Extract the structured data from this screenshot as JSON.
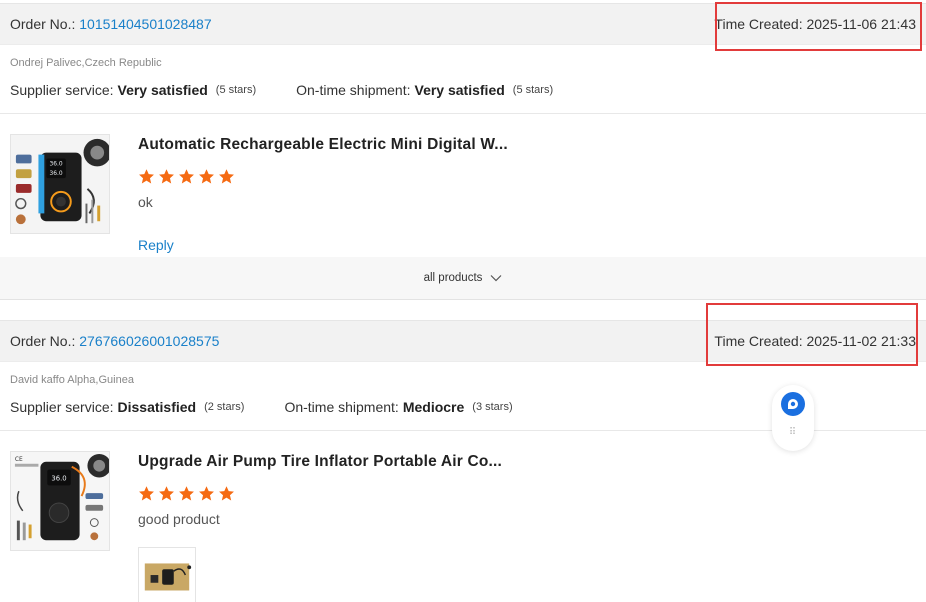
{
  "orders": [
    {
      "order_no_label": "Order No.:",
      "order_no": "10151404501028487",
      "time_created": "Time Created: 2025-11-06 21:43",
      "buyer": "Ondrej Palivec,Czech Republic",
      "supplier_label": "Supplier service:",
      "supplier_value": "Very satisfied",
      "supplier_stars": "(5 stars)",
      "shipment_label": "On-time shipment:",
      "shipment_value": "Very satisfied",
      "shipment_stars": "(5 stars)",
      "product_title": "Automatic Rechargeable Electric Mini Digital W...",
      "rating": 5,
      "comment": "ok",
      "reply_label": "Reply",
      "all_products_label": "all products"
    },
    {
      "order_no_label": "Order No.:",
      "order_no": "276766026001028575",
      "time_created": "Time Created: 2025-11-02 21:33",
      "buyer": "David kaffo Alpha,Guinea",
      "supplier_label": "Supplier service:",
      "supplier_value": "Dissatisfied",
      "supplier_stars": "(2 stars)",
      "shipment_label": "On-time shipment:",
      "shipment_value": "Mediocre",
      "shipment_stars": "(3 stars)",
      "product_title": "Upgrade Air Pump Tire Inflator Portable Air Co...",
      "rating": 5,
      "comment": "good product"
    }
  ],
  "thumb1_text": [
    "36.0",
    "36.0"
  ],
  "thumb2_text": [
    "CE",
    "36.0"
  ],
  "colors": {
    "link": "#1a80c9",
    "star": "#f56a12",
    "highlight_box": "#e23b3b",
    "header_bg": "#f2f2f2"
  },
  "icons": {
    "star": "star-icon",
    "chevron": "chevron-down-icon",
    "chat": "chat-bubble-icon",
    "grip": "drag-handle-icon"
  }
}
